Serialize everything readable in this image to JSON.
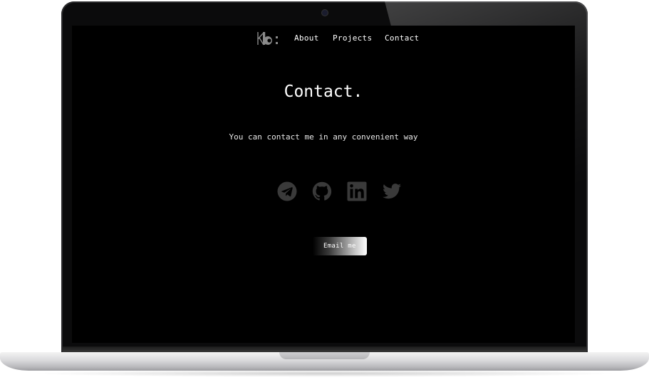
{
  "nav": {
    "logo_text": "kb:",
    "links": [
      "About",
      "Projects",
      "Contact"
    ]
  },
  "page": {
    "title": "Contact.",
    "subtitle": "You can contact me in any convenient way",
    "email_button_label": "Email me"
  },
  "socials": [
    {
      "name": "Telegram",
      "icon": "telegram-icon"
    },
    {
      "name": "GitHub",
      "icon": "github-icon"
    },
    {
      "name": "LinkedIn",
      "icon": "linkedin-icon"
    },
    {
      "name": "Twitter",
      "icon": "twitter-icon"
    }
  ],
  "colors": {
    "background": "#000000",
    "text": "#ffffff",
    "icon": "#3a3a3a"
  }
}
